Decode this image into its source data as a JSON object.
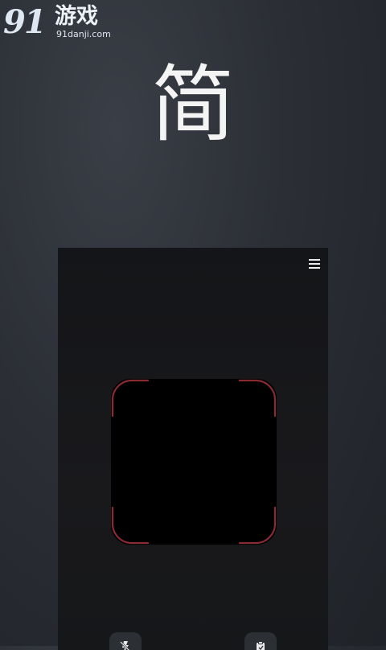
{
  "watermark": {
    "logo": "91",
    "site_cn": "游戏",
    "url": "91danji.com"
  },
  "hero": {
    "title": "简"
  },
  "phone": {
    "menu_icon": "hamburger-menu-icon",
    "scan_frame_color": "#8a2a33",
    "bottom_buttons": [
      {
        "icon": "flash-off-icon"
      },
      {
        "icon": "clipboard-icon"
      }
    ]
  }
}
